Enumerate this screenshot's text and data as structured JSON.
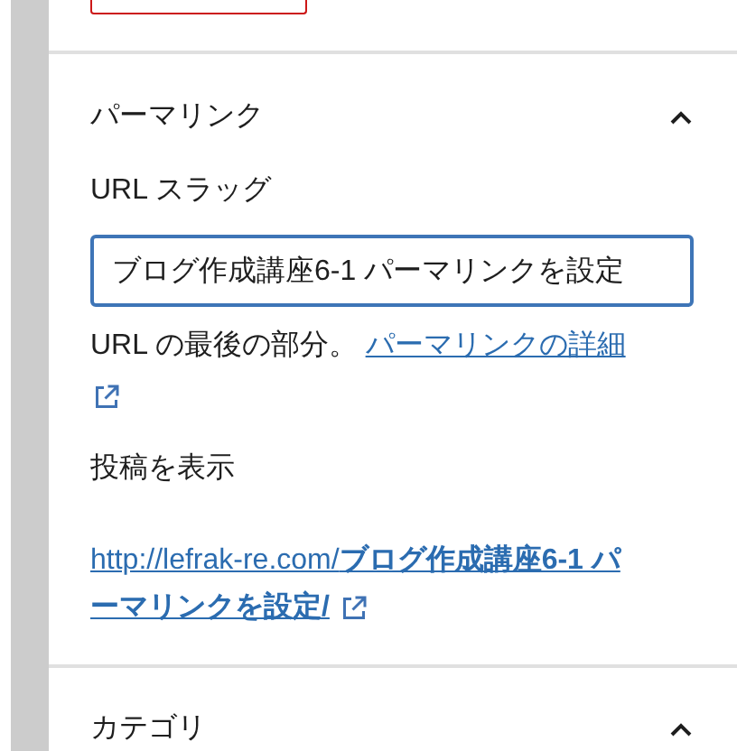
{
  "permalink_panel": {
    "title": "パーマリンク",
    "expanded": true,
    "slug_label": "URL スラッグ",
    "slug_value": "ブログ作成講座6-1 パーマリンクを設定",
    "help_text": "URL の最後の部分。",
    "help_link": "パーマリンクの詳細",
    "view_label": "投稿を表示",
    "view_link": "http://lefrak-re.com/**ブログ作成講座6-1 パーマリンクを設定/**"
  },
  "next_panel": {
    "title": "カテゴリ",
    "expanded": true
  }
}
